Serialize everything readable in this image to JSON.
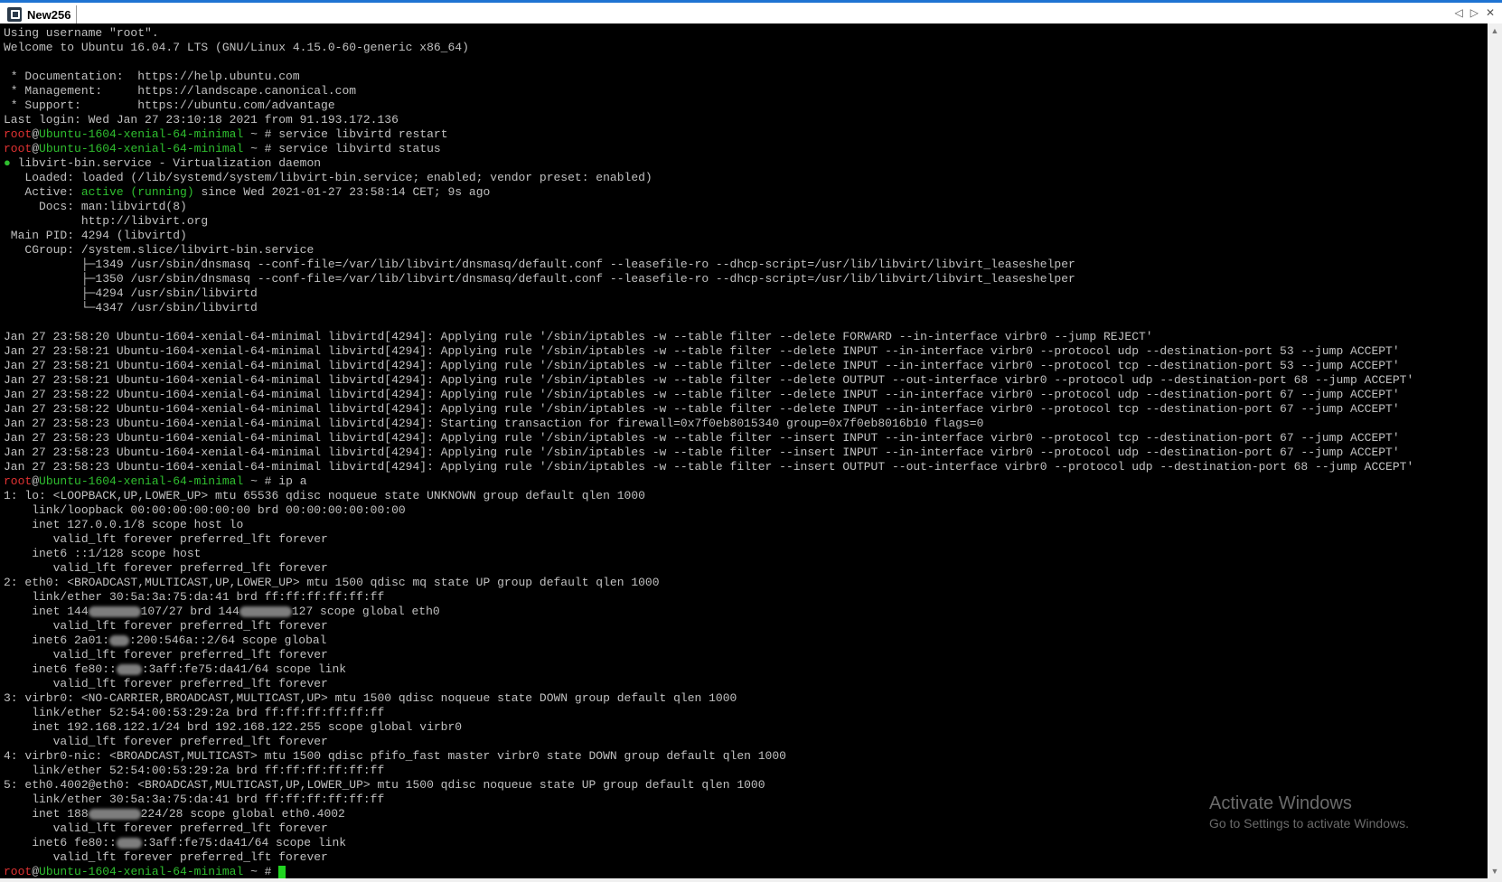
{
  "window": {
    "tab_title": "New256",
    "controls": {
      "prev": "◁",
      "next": "▷",
      "close": "✕"
    }
  },
  "terminal": {
    "colors": {
      "background": "#000000",
      "text": "#c0c0c0",
      "prompt_user": "#e03232",
      "prompt_host": "#2fbf2f",
      "cursor": "#21d321"
    },
    "lines": [
      [
        {
          "t": "Using username \"root\"."
        }
      ],
      [
        {
          "t": "Welcome to Ubuntu 16.04.7 LTS (GNU/Linux 4.15.0-60-generic x86_64)"
        }
      ],
      [
        {
          "t": ""
        }
      ],
      [
        {
          "t": " * Documentation:  https://help.ubuntu.com"
        }
      ],
      [
        {
          "t": " * Management:     https://landscape.canonical.com"
        }
      ],
      [
        {
          "t": " * Support:        https://ubuntu.com/advantage"
        }
      ],
      [
        {
          "t": "Last login: Wed Jan 27 23:10:18 2021 from 91.193.172.136"
        }
      ],
      [
        {
          "t": "root",
          "c": "red"
        },
        {
          "t": "@"
        },
        {
          "t": "Ubuntu-1604-xenial-64-minimal",
          "c": "green"
        },
        {
          "t": " ~ # service libvirtd restart"
        }
      ],
      [
        {
          "t": "root",
          "c": "red"
        },
        {
          "t": "@"
        },
        {
          "t": "Ubuntu-1604-xenial-64-minimal",
          "c": "green"
        },
        {
          "t": " ~ # service libvirtd status"
        }
      ],
      [
        {
          "t": "●",
          "c": "green"
        },
        {
          "t": " libvirt-bin.service - Virtualization daemon"
        }
      ],
      [
        {
          "t": "   Loaded: loaded (/lib/systemd/system/libvirt-bin.service; enabled; vendor preset: enabled)"
        }
      ],
      [
        {
          "t": "   Active: "
        },
        {
          "t": "active (running)",
          "c": "green"
        },
        {
          "t": " since Wed 2021-01-27 23:58:14 CET; 9s ago"
        }
      ],
      [
        {
          "t": "     Docs: man:libvirtd(8)"
        }
      ],
      [
        {
          "t": "           http://libvirt.org"
        }
      ],
      [
        {
          "t": " Main PID: 4294 (libvirtd)"
        }
      ],
      [
        {
          "t": "   CGroup: /system.slice/libvirt-bin.service"
        }
      ],
      [
        {
          "t": "           ├─1349 /usr/sbin/dnsmasq --conf-file=/var/lib/libvirt/dnsmasq/default.conf --leasefile-ro --dhcp-script=/usr/lib/libvirt/libvirt_leaseshelper"
        }
      ],
      [
        {
          "t": "           ├─1350 /usr/sbin/dnsmasq --conf-file=/var/lib/libvirt/dnsmasq/default.conf --leasefile-ro --dhcp-script=/usr/lib/libvirt/libvirt_leaseshelper"
        }
      ],
      [
        {
          "t": "           ├─4294 /usr/sbin/libvirtd"
        }
      ],
      [
        {
          "t": "           └─4347 /usr/sbin/libvirtd"
        }
      ],
      [
        {
          "t": ""
        }
      ],
      [
        {
          "t": "Jan 27 23:58:20 Ubuntu-1604-xenial-64-minimal libvirtd[4294]: Applying rule '/sbin/iptables -w --table filter --delete FORWARD --in-interface virbr0 --jump REJECT'"
        }
      ],
      [
        {
          "t": "Jan 27 23:58:21 Ubuntu-1604-xenial-64-minimal libvirtd[4294]: Applying rule '/sbin/iptables -w --table filter --delete INPUT --in-interface virbr0 --protocol udp --destination-port 53 --jump ACCEPT'"
        }
      ],
      [
        {
          "t": "Jan 27 23:58:21 Ubuntu-1604-xenial-64-minimal libvirtd[4294]: Applying rule '/sbin/iptables -w --table filter --delete INPUT --in-interface virbr0 --protocol tcp --destination-port 53 --jump ACCEPT'"
        }
      ],
      [
        {
          "t": "Jan 27 23:58:21 Ubuntu-1604-xenial-64-minimal libvirtd[4294]: Applying rule '/sbin/iptables -w --table filter --delete OUTPUT --out-interface virbr0 --protocol udp --destination-port 68 --jump ACCEPT'"
        }
      ],
      [
        {
          "t": "Jan 27 23:58:22 Ubuntu-1604-xenial-64-minimal libvirtd[4294]: Applying rule '/sbin/iptables -w --table filter --delete INPUT --in-interface virbr0 --protocol udp --destination-port 67 --jump ACCEPT'"
        }
      ],
      [
        {
          "t": "Jan 27 23:58:22 Ubuntu-1604-xenial-64-minimal libvirtd[4294]: Applying rule '/sbin/iptables -w --table filter --delete INPUT --in-interface virbr0 --protocol tcp --destination-port 67 --jump ACCEPT'"
        }
      ],
      [
        {
          "t": "Jan 27 23:58:23 Ubuntu-1604-xenial-64-minimal libvirtd[4294]: Starting transaction for firewall=0x7f0eb8015340 group=0x7f0eb8016b10 flags=0"
        }
      ],
      [
        {
          "t": "Jan 27 23:58:23 Ubuntu-1604-xenial-64-minimal libvirtd[4294]: Applying rule '/sbin/iptables -w --table filter --insert INPUT --in-interface virbr0 --protocol tcp --destination-port 67 --jump ACCEPT'"
        }
      ],
      [
        {
          "t": "Jan 27 23:58:23 Ubuntu-1604-xenial-64-minimal libvirtd[4294]: Applying rule '/sbin/iptables -w --table filter --insert INPUT --in-interface virbr0 --protocol udp --destination-port 67 --jump ACCEPT'"
        }
      ],
      [
        {
          "t": "Jan 27 23:58:23 Ubuntu-1604-xenial-64-minimal libvirtd[4294]: Applying rule '/sbin/iptables -w --table filter --insert OUTPUT --out-interface virbr0 --protocol udp --destination-port 68 --jump ACCEPT'"
        }
      ],
      [
        {
          "t": "root",
          "c": "red"
        },
        {
          "t": "@"
        },
        {
          "t": "Ubuntu-1604-xenial-64-minimal",
          "c": "green"
        },
        {
          "t": " ~ # ip a"
        }
      ],
      [
        {
          "t": "1: lo: <LOOPBACK,UP,LOWER_UP> mtu 65536 qdisc noqueue state UNKNOWN group default qlen 1000"
        }
      ],
      [
        {
          "t": "    link/loopback 00:00:00:00:00:00 brd 00:00:00:00:00:00"
        }
      ],
      [
        {
          "t": "    inet 127.0.0.1/8 scope host lo"
        }
      ],
      [
        {
          "t": "       valid_lft forever preferred_lft forever"
        }
      ],
      [
        {
          "t": "    inet6 ::1/128 scope host"
        }
      ],
      [
        {
          "t": "       valid_lft forever preferred_lft forever"
        }
      ],
      [
        {
          "t": "2: eth0: <BROADCAST,MULTICAST,UP,LOWER_UP> mtu 1500 qdisc mq state UP group default qlen 1000"
        }
      ],
      [
        {
          "t": "    link/ether 30:5a:3a:75:da:41 brd ff:ff:ff:ff:ff:ff"
        }
      ],
      [
        {
          "t": "    inet 144"
        },
        {
          "blur": true
        },
        {
          "t": "107/27 brd 144"
        },
        {
          "blur": true
        },
        {
          "t": "127 scope global eth0"
        }
      ],
      [
        {
          "t": "       valid_lft forever preferred_lft forever"
        }
      ],
      [
        {
          "t": "    inet6 2a01:"
        },
        {
          "blur": true,
          "w": 22
        },
        {
          "t": ":200:546a::2/64 scope global"
        }
      ],
      [
        {
          "t": "       valid_lft forever preferred_lft forever"
        }
      ],
      [
        {
          "t": "    inet6 fe80::"
        },
        {
          "blur": true,
          "w": 28
        },
        {
          "t": ":3aff:fe75:da41/64 scope link"
        }
      ],
      [
        {
          "t": "       valid_lft forever preferred_lft forever"
        }
      ],
      [
        {
          "t": "3: virbr0: <NO-CARRIER,BROADCAST,MULTICAST,UP> mtu 1500 qdisc noqueue state DOWN group default qlen 1000"
        }
      ],
      [
        {
          "t": "    link/ether 52:54:00:53:29:2a brd ff:ff:ff:ff:ff:ff"
        }
      ],
      [
        {
          "t": "    inet 192.168.122.1/24 brd 192.168.122.255 scope global virbr0"
        }
      ],
      [
        {
          "t": "       valid_lft forever preferred_lft forever"
        }
      ],
      [
        {
          "t": "4: virbr0-nic: <BROADCAST,MULTICAST> mtu 1500 qdisc pfifo_fast master virbr0 state DOWN group default qlen 1000"
        }
      ],
      [
        {
          "t": "    link/ether 52:54:00:53:29:2a brd ff:ff:ff:ff:ff:ff"
        }
      ],
      [
        {
          "t": "5: eth0.4002@eth0: <BROADCAST,MULTICAST,UP,LOWER_UP> mtu 1500 qdisc noqueue state UP group default qlen 1000"
        }
      ],
      [
        {
          "t": "    link/ether 30:5a:3a:75:da:41 brd ff:ff:ff:ff:ff:ff"
        }
      ],
      [
        {
          "t": "    inet 188"
        },
        {
          "blur": true
        },
        {
          "t": "224/28 scope global eth0.4002"
        }
      ],
      [
        {
          "t": "       valid_lft forever preferred_lft forever"
        }
      ],
      [
        {
          "t": "    inet6 fe80::"
        },
        {
          "blur": true,
          "w": 28
        },
        {
          "t": ":3aff:fe75:da41/64 scope link"
        }
      ],
      [
        {
          "t": "       valid_lft forever preferred_lft forever"
        }
      ],
      [
        {
          "t": "root",
          "c": "red"
        },
        {
          "t": "@"
        },
        {
          "t": "Ubuntu-1604-xenial-64-minimal",
          "c": "green"
        },
        {
          "t": " ~ # "
        },
        {
          "cursor": true
        }
      ]
    ]
  },
  "watermark": {
    "title": "Activate Windows",
    "subtitle": "Go to Settings to activate Windows."
  }
}
